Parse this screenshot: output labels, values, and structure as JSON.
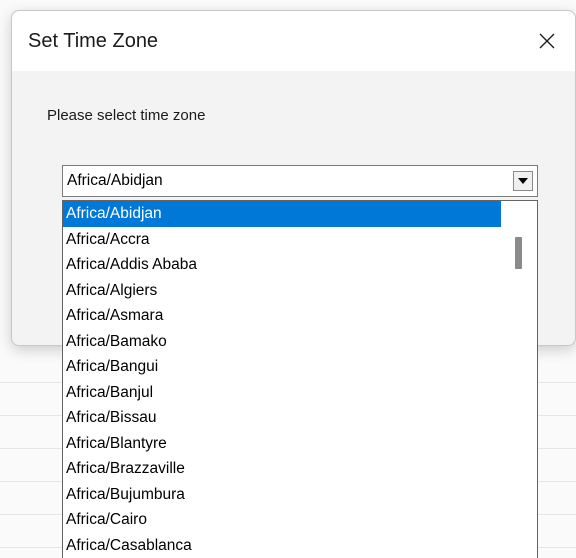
{
  "dialog": {
    "title": "Set Time Zone",
    "prompt": "Please select time zone",
    "close_icon": "close-icon"
  },
  "combo": {
    "value": "Africa/Abidjan",
    "arrow_icon": "chevron-down-icon"
  },
  "list": {
    "selected_index": 0,
    "items": [
      "Africa/Abidjan",
      "Africa/Accra",
      "Africa/Addis Ababa",
      "Africa/Algiers",
      "Africa/Asmara",
      "Africa/Bamako",
      "Africa/Bangui",
      "Africa/Banjul",
      "Africa/Bissau",
      "Africa/Blantyre",
      "Africa/Brazzaville",
      "Africa/Bujumbura",
      "Africa/Cairo",
      "Africa/Casablanca"
    ]
  },
  "colors": {
    "selection": "#0078d7",
    "dialog_bg": "#f3f3f3"
  }
}
